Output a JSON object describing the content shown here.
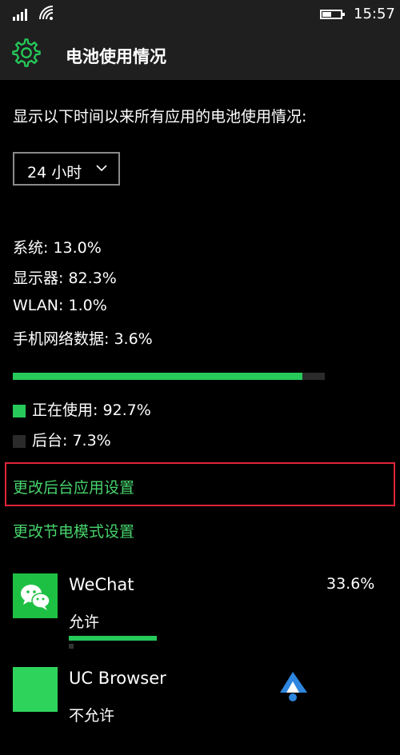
{
  "status_bar": {
    "time": "15:57",
    "battery_level": 0.5
  },
  "header": {
    "title": "电池使用情况",
    "icon": "gear-icon"
  },
  "intro_text": "显示以下时间以来所有应用的电池使用情况:",
  "time_range": {
    "selected": "24 小时"
  },
  "breakdown": [
    {
      "label": "系统",
      "value": "13.0%"
    },
    {
      "label": "显示器",
      "value": "82.3%"
    },
    {
      "label": "WLAN",
      "value": "1.0%"
    },
    {
      "label": "手机网络数据",
      "value": "3.6%"
    }
  ],
  "usage_bar": {
    "in_use_fraction": 0.927
  },
  "legend": [
    {
      "label": "正在使用",
      "value": "92.7%",
      "color": "#26c95a"
    },
    {
      "label": "后台",
      "value": "7.3%",
      "color": "#2b2b2b"
    }
  ],
  "links": {
    "background_apps": "更改后台应用设置",
    "battery_saver": "更改节电模式设置"
  },
  "apps": [
    {
      "name": "WeChat",
      "status": "允许",
      "percent": "33.6%",
      "fraction": 1.0,
      "icon": "wechat-icon"
    },
    {
      "name": "UC Browser",
      "status": "不允许",
      "icon": "uc-browser-icon"
    }
  ],
  "colors": {
    "accent": "#26c95a",
    "link": "#47d46c",
    "highlight": "#e0243a"
  }
}
